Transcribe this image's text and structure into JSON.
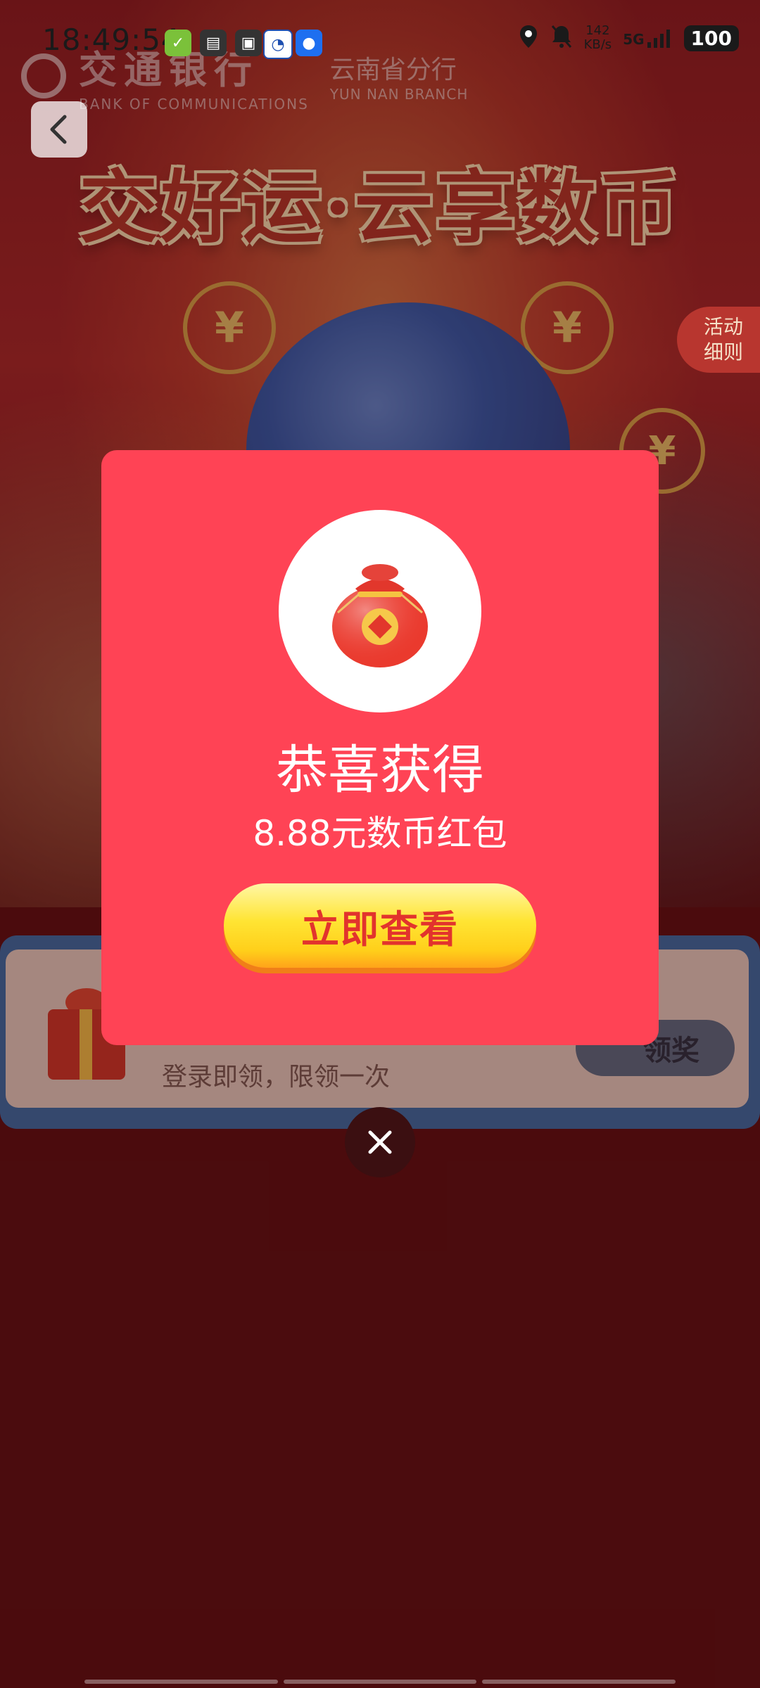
{
  "status_bar": {
    "time": "18:49:54",
    "net_speed_value": "142",
    "net_speed_unit": "KB/s",
    "signal": "5G",
    "battery": "100"
  },
  "hero": {
    "bank_name_cn": "交通银行",
    "bank_name_en": "BANK OF COMMUNICATIONS",
    "branch_cn": "云南省分行",
    "branch_en": "YUN NAN BRANCH",
    "title": "交好运·云享数币",
    "rules_label_line1": "活动",
    "rules_label_line2": "细则"
  },
  "login_card": {
    "description": "登录即领，限领一次",
    "claim_button": "领奖"
  },
  "modal": {
    "title": "恭喜获得",
    "subtitle": "8.88元数币红包",
    "view_button": "立即查看",
    "icon": "lucky-bag-icon"
  },
  "colors": {
    "modal_bg": "#ff4355",
    "page_bg": "#5e1215",
    "button_text": "#e2332d"
  }
}
